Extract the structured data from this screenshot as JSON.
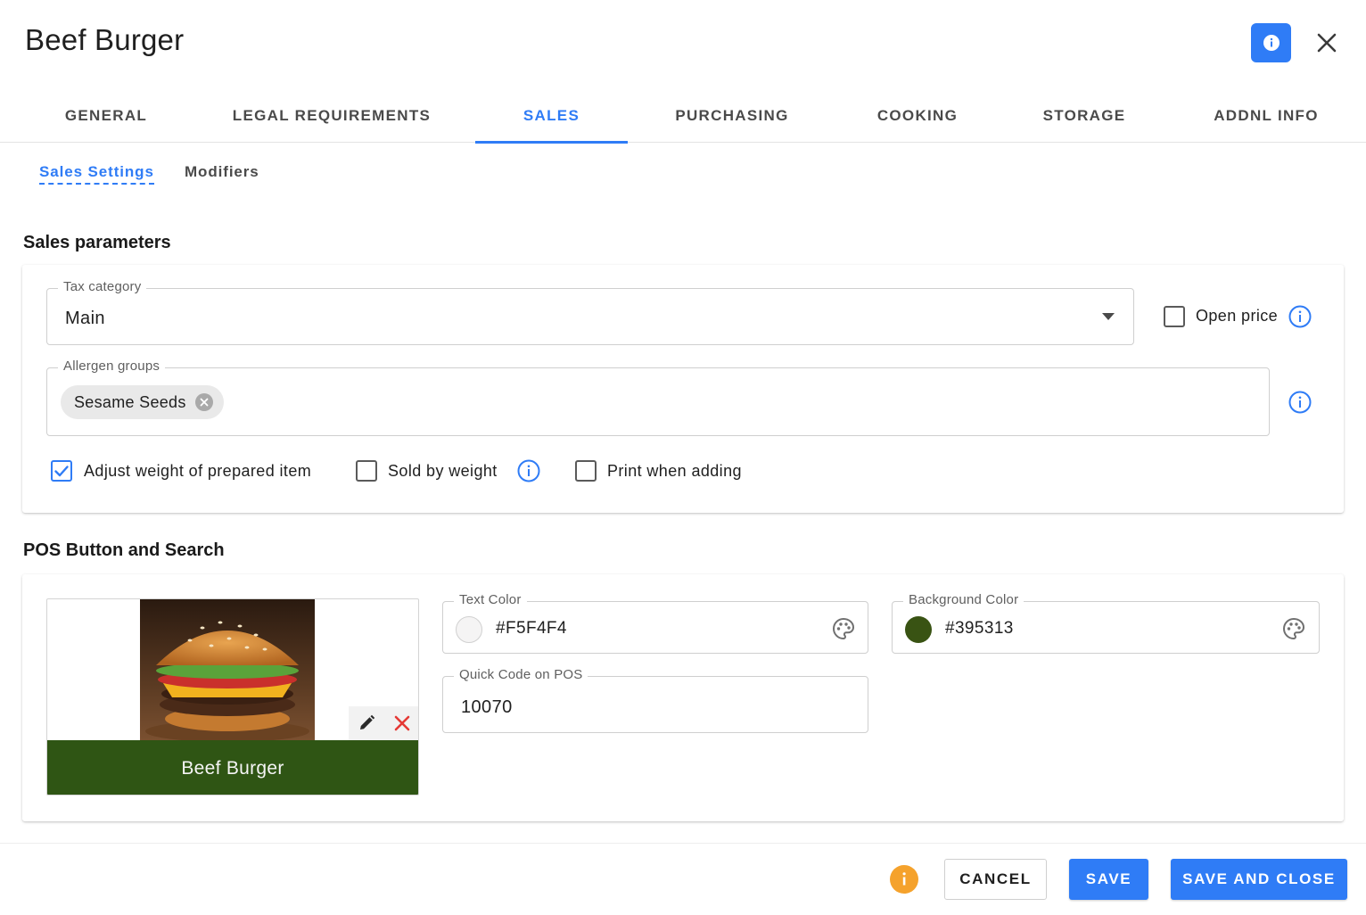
{
  "dialog": {
    "title": "Beef Burger"
  },
  "tabs": [
    {
      "label": "GENERAL"
    },
    {
      "label": "LEGAL REQUIREMENTS"
    },
    {
      "label": "SALES"
    },
    {
      "label": "PURCHASING"
    },
    {
      "label": "COOKING"
    },
    {
      "label": "STORAGE"
    },
    {
      "label": "ADDNL INFO"
    }
  ],
  "active_tab": "SALES",
  "subtabs": [
    {
      "label": "Sales Settings"
    },
    {
      "label": "Modifiers"
    }
  ],
  "active_subtab": "Sales Settings",
  "sales_parameters": {
    "title": "Sales parameters",
    "tax_category": {
      "label": "Tax category",
      "value": "Main"
    },
    "open_price": {
      "label": "Open price",
      "checked": false
    },
    "allergen_groups": {
      "label": "Allergen groups",
      "chips": [
        "Sesame Seeds"
      ]
    },
    "adjust_weight": {
      "label": "Adjust weight of prepared item",
      "checked": true
    },
    "sold_by_weight": {
      "label": "Sold by weight",
      "checked": false
    },
    "print_when_adding": {
      "label": "Print when adding",
      "checked": false
    }
  },
  "pos_button": {
    "title": "POS Button and Search",
    "preview_caption": "Beef Burger",
    "text_color": {
      "label": "Text Color",
      "value": "#F5F4F4"
    },
    "background_color": {
      "label": "Background Color",
      "value": "#395313"
    },
    "quick_code": {
      "label": "Quick Code on POS",
      "value": "10070"
    }
  },
  "footer": {
    "cancel_label": "CANCEL",
    "save_label": "SAVE",
    "save_close_label": "SAVE AND CLOSE"
  },
  "colors": {
    "accent": "#2f7cf6",
    "warning": "#f5a22c",
    "preview_bg": "#2f5514",
    "text_swatch": "#F5F4F4",
    "background_swatch": "#395313"
  },
  "icons": {
    "header_info": "info-icon",
    "close": "close-icon",
    "dropdown": "chevron-down-icon",
    "chip_remove": "cancel-circle-icon",
    "field_info": "info-outline-icon",
    "edit": "pencil-icon",
    "delete": "close-icon",
    "palette": "palette-icon",
    "footer_warning": "info-icon"
  }
}
